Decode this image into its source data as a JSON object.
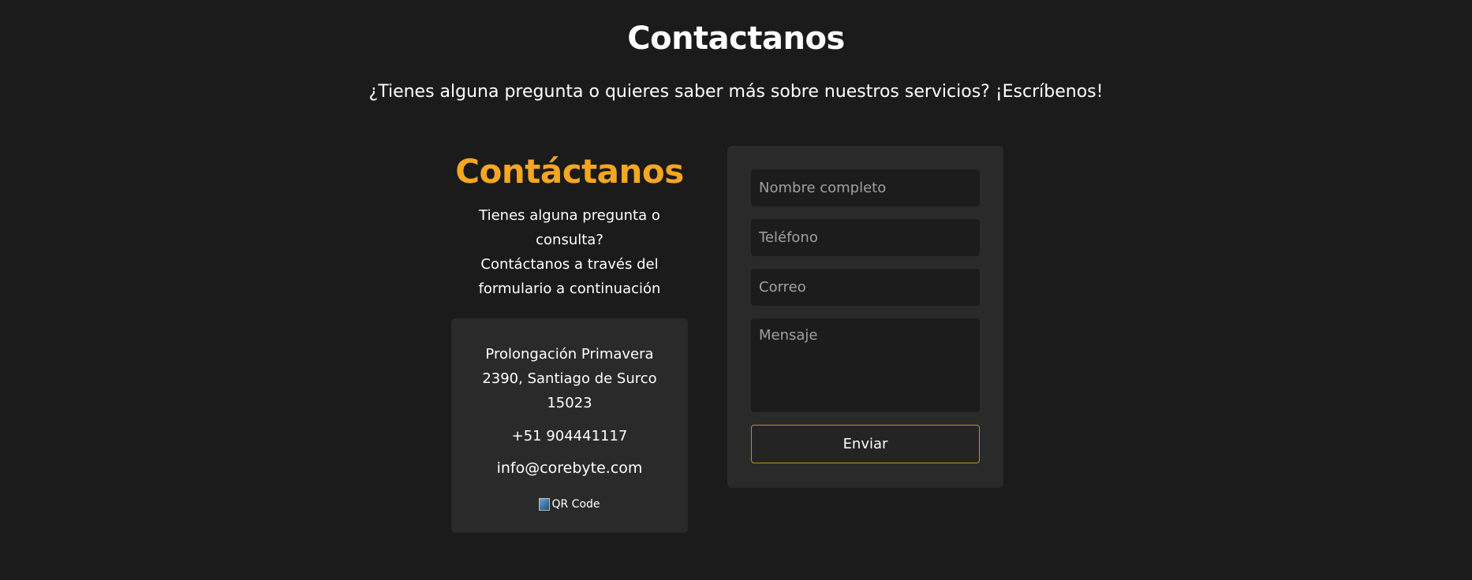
{
  "header": {
    "title": "Contactanos",
    "subtitle": "¿Tienes alguna pregunta o quieres saber más sobre nuestros servicios? ¡Escríbenos!"
  },
  "info": {
    "heading": "Contáctanos",
    "intro_line1": "Tienes alguna pregunta o consulta?",
    "intro_line2": "Contáctanos a través del formulario a continuación",
    "address": "Prolongación Primavera 2390, Santiago de Surco 15023",
    "phone": "+51 904441117",
    "email": "info@corebyte.com",
    "qr_alt": "QR Code"
  },
  "form": {
    "name_placeholder": "Nombre completo",
    "phone_placeholder": "Teléfono",
    "email_placeholder": "Correo",
    "message_placeholder": "Mensaje",
    "submit_label": "Enviar"
  },
  "colors": {
    "background": "#1b1b1b",
    "card": "#2a2a2a",
    "accent": "#f5a623",
    "button_border": "#c48a2a"
  }
}
